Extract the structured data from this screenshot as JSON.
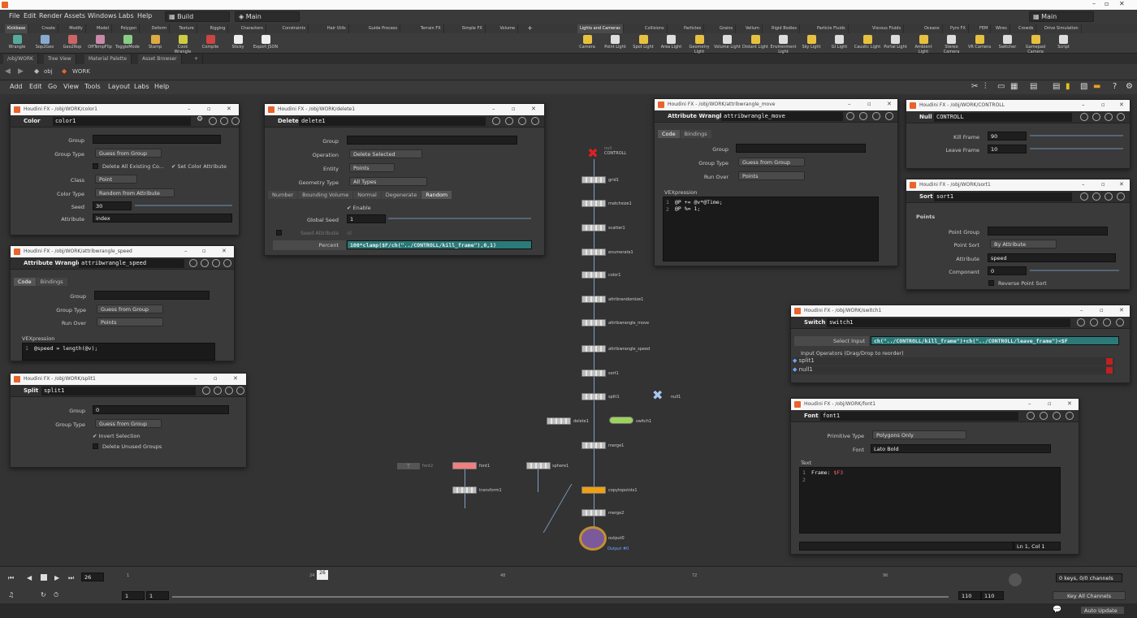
{
  "menubar": {
    "items": [
      "File",
      "Edit",
      "Render",
      "Assets",
      "Windows",
      "Labs",
      "Help"
    ],
    "desktop": "Build",
    "context": "Main",
    "right_desktop": "Main"
  },
  "shelf_tabs_left": [
    "Kickbase",
    "Create",
    "Modify",
    "Model",
    "Polygon",
    "Deform",
    "Texture",
    "Rigging",
    "Characters",
    "Constraints",
    "Hair Utils",
    "Guide Process",
    "Terrain FX",
    "Simple FX",
    "Volume"
  ],
  "shelf_tabs_right": [
    "Lights and Cameras",
    "Collisions",
    "Particles",
    "Grains",
    "Vellum",
    "Rigid Bodies",
    "Particle Fluids",
    "Viscous Fluids",
    "Oceans",
    "Pyro FX",
    "FEM",
    "Wires",
    "Crowds",
    "Drive Simulation"
  ],
  "shelf_tools_left": [
    "Wrangle",
    "Sop2Geo",
    "Geo2Rop",
    "OffTempFlip",
    "ToggleMode",
    "Stamp",
    "Cook Wrangle",
    "Compile",
    "Sticky",
    "Export JSON"
  ],
  "shelf_tools_right": [
    "Camera",
    "Point Light",
    "Spot Light",
    "Area Light",
    "Geometry Light",
    "Volume Light",
    "Distant Light",
    "Environment Light",
    "Sky Light",
    "GI Light",
    "Caustic Light",
    "Portal Light",
    "Ambient Light",
    "Stereo Camera",
    "VR Camera",
    "Switcher",
    "Gamepad Camera",
    "Script"
  ],
  "pane_tabs": [
    "/obj/WORK",
    "Tree View",
    "Material Palette",
    "Asset Browser"
  ],
  "path": [
    "obj",
    "WORK"
  ],
  "net_menu": [
    "Add",
    "Edit",
    "Go",
    "View",
    "Tools",
    "Layout",
    "Labs",
    "Help"
  ],
  "nodes": [
    {
      "name": "CONTROLL",
      "tag": "null"
    },
    {
      "name": "grid1"
    },
    {
      "name": "matchsize1"
    },
    {
      "name": "scatter1"
    },
    {
      "name": "enumerate1"
    },
    {
      "name": "color1"
    },
    {
      "name": "attribrandomize1"
    },
    {
      "name": "attribwrangle_move"
    },
    {
      "name": "attribwrangle_speed"
    },
    {
      "name": "sort1"
    },
    {
      "name": "split1"
    },
    {
      "name": "null1"
    },
    {
      "name": "delete1"
    },
    {
      "name": "switch1"
    },
    {
      "name": "merge1"
    },
    {
      "name": "font2"
    },
    {
      "name": "font1"
    },
    {
      "name": "sphere1"
    },
    {
      "name": "transform1"
    },
    {
      "name": "copytopoints1"
    },
    {
      "name": "merge2"
    },
    {
      "name": "output0"
    },
    {
      "name": "Output #0"
    }
  ],
  "color_panel": {
    "title": "Houdini FX - /obj/WORK/color1",
    "type": "Color",
    "name": "color1",
    "group_label": "Group",
    "group_type_label": "Group Type",
    "group_type": "Guess from Group",
    "delete_all": "Delete All Existing Co...",
    "set_color_attr": "Set Color Attribute",
    "class_label": "Class",
    "class": "Point",
    "color_type_label": "Color Type",
    "color_type": "Random from Attribute",
    "seed_label": "Seed",
    "seed": "30",
    "attribute_label": "Attribute",
    "attribute": "index"
  },
  "speed_panel": {
    "title": "Houdini FX - /obj/WORK/attribwrangle_speed",
    "type": "Attribute Wrangle",
    "name": "attribwrangle_speed",
    "tabs": [
      "Code",
      "Bindings"
    ],
    "group_label": "Group",
    "group_type_label": "Group Type",
    "group_type": "Guess from Group",
    "run_over_label": "Run Over",
    "run_over": "Points",
    "vex_label": "VEXpression",
    "code": "@speed = length(@v);"
  },
  "split_panel": {
    "title": "Houdini FX - /obj/WORK/split1",
    "type": "Split",
    "name": "split1",
    "group_label": "Group",
    "group": "0",
    "group_type_label": "Group Type",
    "group_type": "Guess from Group",
    "invert": "Invert Selection",
    "delete_unused": "Delete Unused Groups"
  },
  "delete_panel": {
    "title": "Houdini FX - /obj/WORK/delete1",
    "type": "Delete",
    "name": "delete1",
    "group_label": "Group",
    "operation_label": "Operation",
    "operation": "Delete Selected",
    "entity_label": "Entity",
    "entity": "Points",
    "geo_type_label": "Geometry Type",
    "geo_type": "All Types",
    "tabs": [
      "Number",
      "Bounding Volume",
      "Normal",
      "Degenerate",
      "Random"
    ],
    "enable": "Enable",
    "global_seed_label": "Global Seed",
    "global_seed": "1",
    "seed_attr_label": "Seed Attribute",
    "seed_attr": "id",
    "percent_label": "Percent",
    "percent": "100*clamp($F/ch(\"../CONTROLL/kill_frame\"),0,1)"
  },
  "move_panel": {
    "title": "Houdini FX - /obj/WORK/attribwrangle_move",
    "type": "Attribute Wrangle",
    "name": "attribwrangle_move",
    "tabs": [
      "Code",
      "Bindings"
    ],
    "group_label": "Group",
    "group_type_label": "Group Type",
    "group_type": "Guess from Group",
    "run_over_label": "Run Over",
    "run_over": "Points",
    "vex_label": "VEXpression",
    "code1": "@P += @v*@Time;",
    "code2": "@P %= 1;"
  },
  "controll_panel": {
    "title": "Houdini FX - /obj/WORK/CONTROLL",
    "type": "Null",
    "name": "CONTROLL",
    "kill_label": "Kill Frame",
    "kill": "90",
    "leave_label": "Leave Frame",
    "leave": "10"
  },
  "sort_panel": {
    "title": "Houdini FX - /obj/WORK/sort1",
    "type": "Sort",
    "name": "sort1",
    "section": "Points",
    "point_group_label": "Point Group",
    "point_sort_label": "Point Sort",
    "point_sort": "By Attribute",
    "attribute_label": "Attribute",
    "attribute": "speed",
    "component_label": "Component",
    "component": "0",
    "reverse": "Reverse Point Sort"
  },
  "switch_panel": {
    "title": "Houdini FX - /obj/WORK/switch1",
    "type": "Switch",
    "name": "switch1",
    "select_label": "Select Input",
    "select": "ch(\"../CONTROLL/kill_frame\")+ch(\"../CONTROLL/leave_frame\")<$F",
    "list_header": "Input Operators (Drag/Drop to reorder)",
    "inputs": [
      "split1",
      "null1"
    ]
  },
  "font_panel": {
    "title": "Houdini FX - /obj/WORK/font1",
    "type": "Font",
    "name": "font1",
    "prim_type_label": "Primitive Type",
    "prim_type": "Polygons Only",
    "font_label": "Font",
    "font": "Lato Bold",
    "text_label": "Text",
    "text_key": "Frame: ",
    "text_var": "$F3",
    "status": "Ln 1, Col 1"
  },
  "timeline": {
    "frame": "26",
    "ticks": [
      "1",
      "24",
      "48",
      "72",
      "96"
    ],
    "cursor": "26",
    "start": "1",
    "start2": "1",
    "end": "110",
    "end2": "110",
    "keys": "0 keys, 0/0 channels",
    "key_all": "Key All Channels",
    "auto_update": "Auto Update"
  }
}
